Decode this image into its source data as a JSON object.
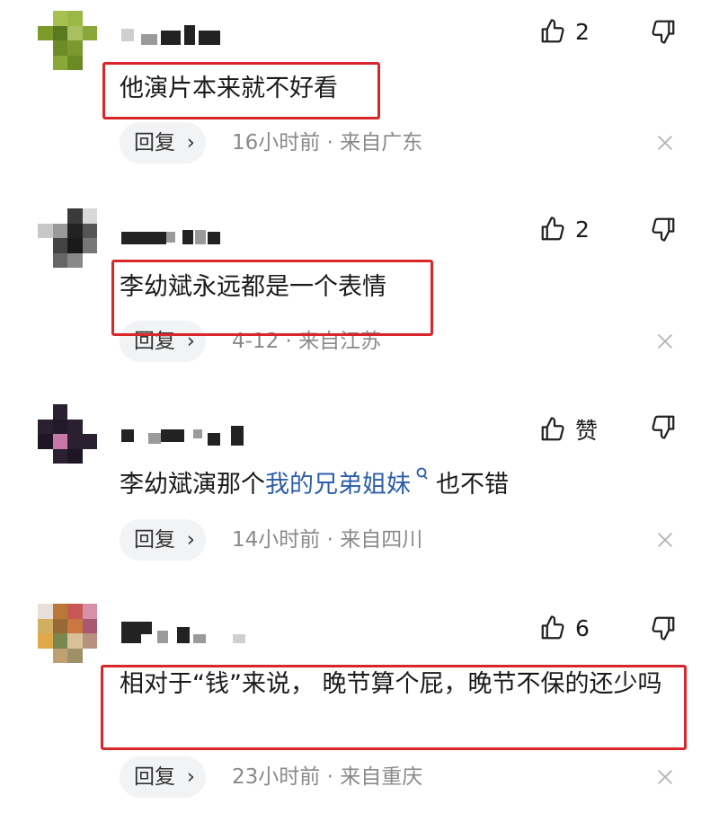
{
  "comments": [
    {
      "text_parts": [
        "他演片本来就不好看"
      ],
      "likes": "2",
      "reply_label": "回复",
      "reply_chevron": "›",
      "time": "16小时前",
      "separator": "·",
      "location": "来自广东",
      "highlighted": true
    },
    {
      "text_parts": [
        "李幼斌永远都是一个表情"
      ],
      "likes": "2",
      "reply_label": "回复",
      "reply_chevron": "›",
      "time": "4-12",
      "separator": "·",
      "location": "来自江苏",
      "highlighted": true
    },
    {
      "text_before": "李幼斌演那个",
      "link_text": "我的兄弟姐妹",
      "text_after": "也不错",
      "likes": "赞",
      "reply_label": "回复",
      "reply_chevron": "›",
      "time": "14小时前",
      "separator": "·",
      "location": "来自四川",
      "highlighted": false
    },
    {
      "text": "相对于“钱”来说， 晚节算个屁，晚节不保的还少吗",
      "likes": "6",
      "reply_label": "回复",
      "reply_chevron": "›",
      "time": "23小时前",
      "separator": "·",
      "location": "来自重庆",
      "highlighted": true
    }
  ],
  "colors": {
    "highlight_box": "#d9262a",
    "link": "#2d5fa8",
    "meta": "#8a8a8a",
    "reply_bg": "#f2f3f5"
  },
  "icons": {
    "like": "thumbs-up-icon",
    "dislike": "thumbs-down-icon",
    "close": "close-icon",
    "search": "search-icon",
    "avatar": "pixelated-avatar"
  }
}
